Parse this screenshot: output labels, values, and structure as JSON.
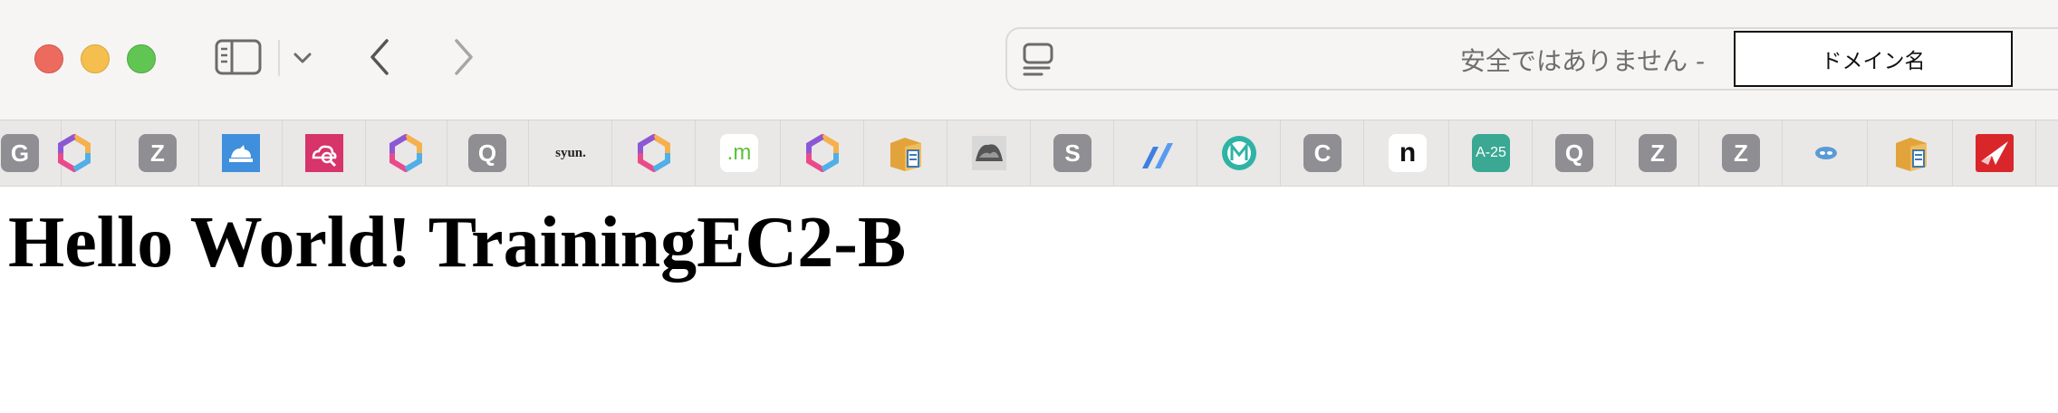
{
  "window": {
    "controls": [
      "close",
      "minimize",
      "maximize"
    ]
  },
  "toolbar": {
    "sidebar_icon": "sidebar-icon",
    "back_icon": "chevron-left-icon",
    "forward_icon": "chevron-right-icon"
  },
  "address_bar": {
    "security_text": "安全ではありません -",
    "domain_label": "ドメイン名",
    "page_icon": "reader-icon"
  },
  "favorites": [
    {
      "kind": "letter",
      "label": "G"
    },
    {
      "kind": "hexagon-logo",
      "label": ""
    },
    {
      "kind": "letter",
      "label": "Z"
    },
    {
      "kind": "blue-cat-logo",
      "label": ""
    },
    {
      "kind": "pink-cloud-logo",
      "label": ""
    },
    {
      "kind": "hexagon-logo",
      "label": ""
    },
    {
      "kind": "letter",
      "label": "Q"
    },
    {
      "kind": "text",
      "label": "syun."
    },
    {
      "kind": "hexagon-logo",
      "label": ""
    },
    {
      "kind": "text-green",
      "label": ".m"
    },
    {
      "kind": "hexagon-logo",
      "label": ""
    },
    {
      "kind": "box-logo",
      "label": ""
    },
    {
      "kind": "photo-logo",
      "label": ""
    },
    {
      "kind": "letter",
      "label": "S"
    },
    {
      "kind": "slash-logo",
      "label": ""
    },
    {
      "kind": "circle-m-logo",
      "label": ""
    },
    {
      "kind": "letter",
      "label": "C"
    },
    {
      "kind": "n-logo",
      "label": "n"
    },
    {
      "kind": "a25-logo",
      "label": "A-25"
    },
    {
      "kind": "letter",
      "label": "Q"
    },
    {
      "kind": "letter",
      "label": "Z"
    },
    {
      "kind": "letter",
      "label": "Z"
    },
    {
      "kind": "blob-logo",
      "label": ""
    },
    {
      "kind": "box-logo",
      "label": ""
    },
    {
      "kind": "red-plane-logo",
      "label": ""
    }
  ],
  "page": {
    "heading": "Hello World! TrainingEC2-B"
  }
}
